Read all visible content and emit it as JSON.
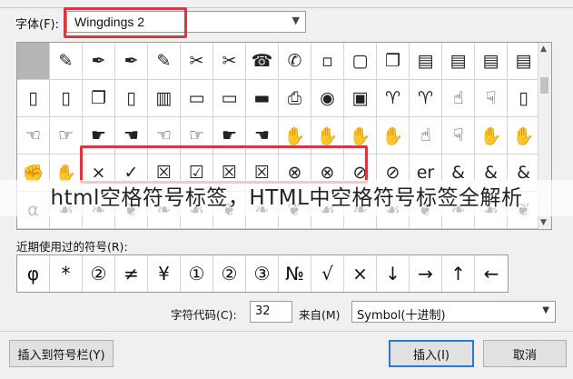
{
  "font_label": "字体(F):",
  "font_value": "Wingdings 2",
  "symbol_grid": [
    [
      "",
      "✎",
      "✒",
      "✒",
      "✎",
      "✂",
      "✂",
      "☎",
      "✆",
      "▫",
      "▢",
      "❐",
      "▤",
      "▤",
      "▤",
      "▤"
    ],
    [
      "▯",
      "▯",
      "❐",
      "▯",
      "▥",
      "▭",
      "▭",
      "▬",
      "⎙",
      "◉",
      "▣",
      "♈",
      "♈",
      "☝",
      "☟",
      "▯"
    ],
    [
      "☜",
      "☞",
      "☛",
      "☚",
      "☜",
      "☞",
      "☛",
      "☚",
      "✋",
      "✋",
      "✋",
      "✋",
      "☝",
      "☟",
      "✋",
      "✋"
    ],
    [
      "✊",
      "✋",
      "×",
      "✓",
      "☒",
      "☑",
      "☒",
      "☒",
      "⊗",
      "⊗",
      "⊘",
      "⊘",
      "er",
      "&",
      "&",
      "&"
    ],
    [
      "⍺",
      "☙",
      "❧",
      "❦",
      "❧",
      "☙",
      "❦",
      "❧",
      "❦",
      "☙",
      "❧",
      "☙",
      "❦",
      "❧",
      "☙",
      "❦"
    ]
  ],
  "watermark_text": "html空格符号标签，HTML中空格符号标签全解析",
  "recent_label": "近期使用过的符号(R):",
  "recent_symbols": [
    "φ",
    "*",
    "②",
    "≠",
    "¥",
    "①",
    "②",
    "③",
    "№",
    "√",
    "×",
    "↓",
    "→",
    "↑",
    "←"
  ],
  "char_code_label": "字符代码(C):",
  "char_code_value": "32",
  "from_label": "来自(M)",
  "from_value": "Symbol(十进制)",
  "buttons": {
    "insert_to_toolbar": "插入到符号栏(Y)",
    "insert": "插入(I)",
    "cancel": "取消"
  },
  "scroll": {
    "up": "▲",
    "down": "▼"
  },
  "chevron": "▼",
  "colors": {
    "highlight": "#d9363e",
    "selected_cell": "#b5b5b5",
    "default_button_border": "#2b78d8"
  }
}
